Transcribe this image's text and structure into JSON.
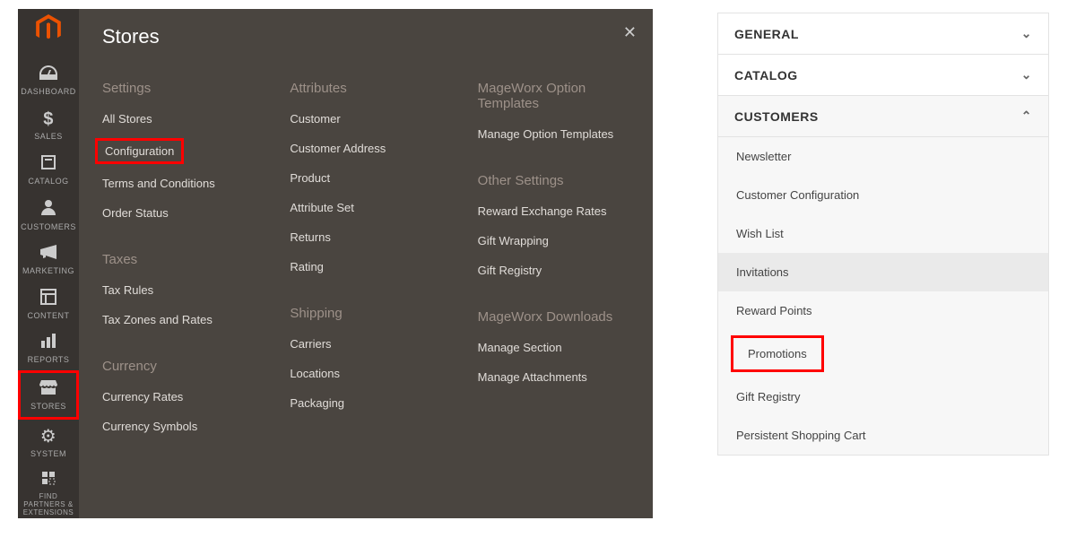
{
  "sidebar": {
    "items": [
      {
        "label": "DASHBOARD",
        "icon": "◐"
      },
      {
        "label": "SALES",
        "icon": "$"
      },
      {
        "label": "CATALOG",
        "icon": "▣"
      },
      {
        "label": "CUSTOMERS",
        "icon": "👤"
      },
      {
        "label": "MARKETING",
        "icon": "📣"
      },
      {
        "label": "CONTENT",
        "icon": "▦"
      },
      {
        "label": "REPORTS",
        "icon": "📊"
      },
      {
        "label": "STORES",
        "icon": "🏬",
        "active": true
      },
      {
        "label": "SYSTEM",
        "icon": "⚙"
      },
      {
        "label": "FIND PARTNERS & EXTENSIONS",
        "icon": "⬚"
      }
    ]
  },
  "stores_panel": {
    "title": "Stores",
    "col1": {
      "h_settings": "Settings",
      "all_stores": "All Stores",
      "configuration": "Configuration",
      "terms": "Terms and Conditions",
      "order_status": "Order Status",
      "h_taxes": "Taxes",
      "tax_rules": "Tax Rules",
      "tax_zones": "Tax Zones and Rates",
      "h_currency": "Currency",
      "currency_rates": "Currency Rates",
      "currency_symbols": "Currency Symbols"
    },
    "col2": {
      "h_attributes": "Attributes",
      "customer": "Customer",
      "customer_address": "Customer Address",
      "product": "Product",
      "attribute_set": "Attribute Set",
      "returns": "Returns",
      "rating": "Rating",
      "h_shipping": "Shipping",
      "carriers": "Carriers",
      "locations": "Locations",
      "packaging": "Packaging"
    },
    "col3": {
      "h_mw_templates": "MageWorx Option Templates",
      "manage_templates": "Manage Option Templates",
      "h_other": "Other Settings",
      "reward_rates": "Reward Exchange Rates",
      "gift_wrapping": "Gift Wrapping",
      "gift_registry": "Gift Registry",
      "h_mw_downloads": "MageWorx Downloads",
      "manage_section": "Manage Section",
      "manage_attachments": "Manage Attachments"
    }
  },
  "config": {
    "general": "GENERAL",
    "catalog": "CATALOG",
    "customers": "CUSTOMERS",
    "items": {
      "newsletter": "Newsletter",
      "customer_config": "Customer Configuration",
      "wish_list": "Wish List",
      "invitations": "Invitations",
      "reward_points": "Reward Points",
      "promotions": "Promotions",
      "gift_registry": "Gift Registry",
      "persistent": "Persistent Shopping Cart"
    }
  }
}
